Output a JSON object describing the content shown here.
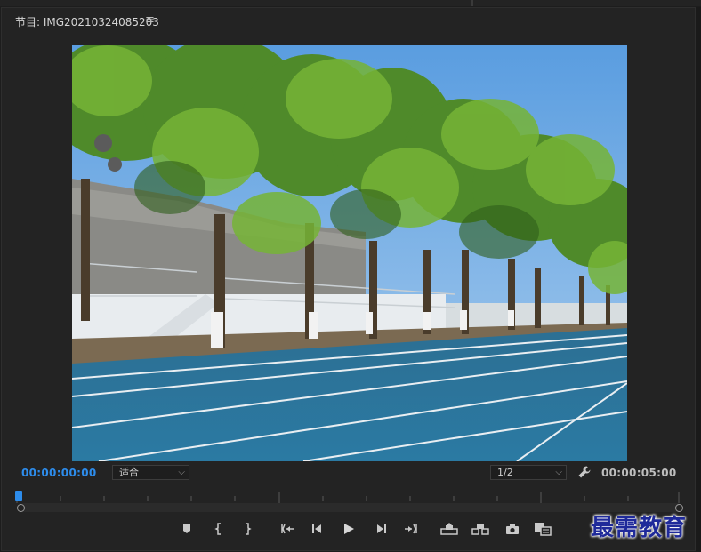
{
  "panel": {
    "title": "节目: IMG20210324085203",
    "menu_glyph": "≡"
  },
  "viewer": {
    "image_subject": "campus running track lined with green trees"
  },
  "timecode": {
    "current": "00:00:00:00",
    "duration": "00:00:05:00"
  },
  "zoom_select": {
    "value": "适合"
  },
  "resolution_select": {
    "value": "1/2"
  },
  "playhead_position": 0.0,
  "controls": [
    {
      "name": "add-marker-icon",
      "label": "Add Marker"
    },
    {
      "name": "mark-in-icon",
      "label": "Mark In"
    },
    {
      "name": "mark-out-icon",
      "label": "Mark Out"
    },
    {
      "name": "go-to-in-icon",
      "label": "Go to In"
    },
    {
      "name": "step-back-icon",
      "label": "Step Back 1 Frame"
    },
    {
      "name": "play-icon",
      "label": "Play-Stop Toggle"
    },
    {
      "name": "step-forward-icon",
      "label": "Step Forward 1 Frame"
    },
    {
      "name": "go-to-out-icon",
      "label": "Go to Out"
    },
    {
      "name": "lift-icon",
      "label": "Lift"
    },
    {
      "name": "extract-icon",
      "label": "Extract"
    },
    {
      "name": "camera-icon",
      "label": "Export Frame"
    },
    {
      "name": "comparison-view-icon",
      "label": "Comparison View"
    }
  ],
  "watermark": "最需教育",
  "colors": {
    "timecode_active": "#2d8ceb",
    "panel_bg": "#232323",
    "watermark": "#1f2a9a"
  }
}
